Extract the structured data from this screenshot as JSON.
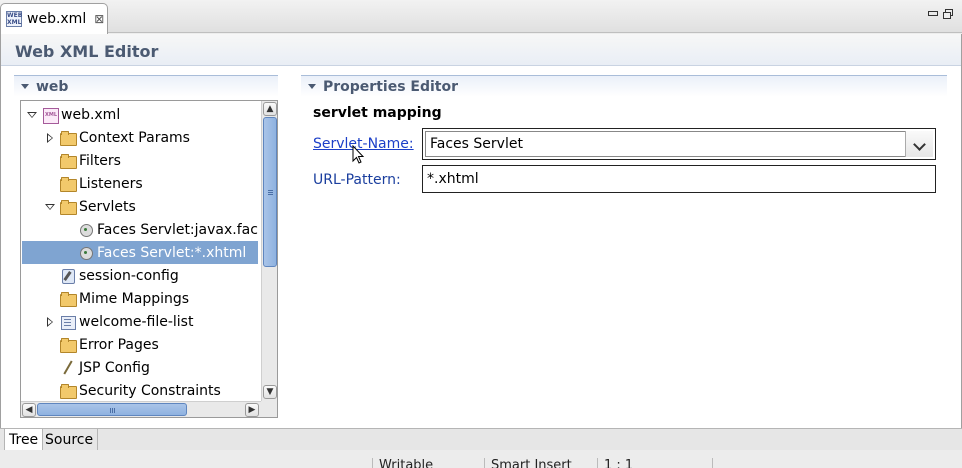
{
  "editor_tab": {
    "icon": "web-xml-file-icon",
    "label": "web.xml",
    "close": "⊠"
  },
  "editor": {
    "title": "Web XML Editor"
  },
  "tree_section": {
    "title": "web",
    "items": [
      {
        "label": "web.xml",
        "expander": "open",
        "icon": "xml-file-icon"
      },
      {
        "label": "Context Params",
        "expander": "closed",
        "icon": "folder-icon"
      },
      {
        "label": "Filters",
        "expander": "none",
        "icon": "folder-icon"
      },
      {
        "label": "Listeners",
        "expander": "none",
        "icon": "folder-icon"
      },
      {
        "label": "Servlets",
        "expander": "open",
        "icon": "folder-icon"
      },
      {
        "label": "Faces Servlet:javax.faces.webapp.FacesServlet",
        "expander": "none",
        "icon": "servlet-icon"
      },
      {
        "label": "Faces Servlet:*.xhtml",
        "expander": "none",
        "icon": "servlet-icon",
        "selected": true
      },
      {
        "label": "session-config",
        "expander": "none",
        "icon": "config-icon"
      },
      {
        "label": "Mime Mappings",
        "expander": "none",
        "icon": "folder-icon"
      },
      {
        "label": "welcome-file-list",
        "expander": "closed",
        "icon": "list-icon"
      },
      {
        "label": "Error Pages",
        "expander": "none",
        "icon": "folder-icon"
      },
      {
        "label": "JSP Config",
        "expander": "none",
        "icon": "pen-icon"
      },
      {
        "label": "Security Constraints",
        "expander": "none",
        "icon": "folder-icon"
      }
    ]
  },
  "properties": {
    "title": "Properties Editor",
    "subtitle": "servlet mapping",
    "servlet_name_label": "Servlet-Name:",
    "servlet_name_value": "Faces Servlet",
    "url_pattern_label": "URL-Pattern:",
    "url_pattern_value": "*.xhtml"
  },
  "bottom_tabs": [
    {
      "label": "Tree",
      "active": true
    },
    {
      "label": "Source",
      "active": false
    }
  ],
  "status": {
    "writable": "Writable",
    "insert_mode": "Smart Insert",
    "position": "1 : 1"
  }
}
